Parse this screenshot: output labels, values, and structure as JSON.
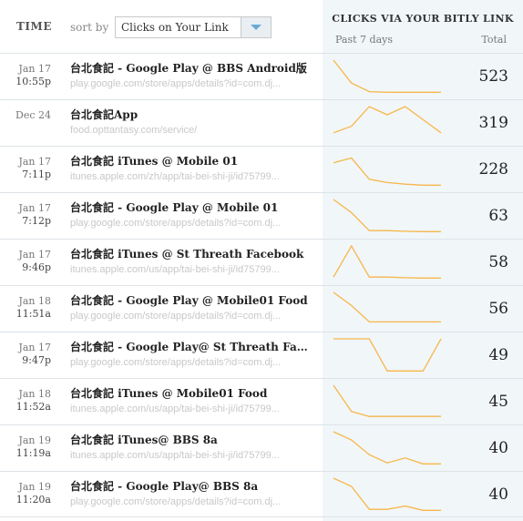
{
  "header": {
    "time_label": "TIME",
    "sort_label": "sort by",
    "sort_value": "Clicks on Your Link",
    "stats_title": "CLICKS VIA YOUR BITLY LINK",
    "past_label": "Past 7 days",
    "total_label": "Total"
  },
  "colors": {
    "spark_line": "#f6b74a",
    "stats_bg": "#f1f6f9",
    "dropdown_arrow": "#6aa9d6"
  },
  "rows": [
    {
      "date": "Jan 17",
      "time": "10:55p",
      "title": "台北食記 - Google Play @ BBS Android版",
      "url": "play.google.com/store/apps/details?id=com.dj...",
      "total": "523",
      "spark": [
        100,
        30,
        4,
        2,
        2,
        2,
        2
      ]
    },
    {
      "date": "Dec 24",
      "time": "",
      "title": "台北食記App",
      "url": "food.opttantasy.com/service/",
      "total": "319",
      "spark": [
        20,
        40,
        100,
        75,
        100,
        60,
        20
      ]
    },
    {
      "date": "Jan 17",
      "time": "7:11p",
      "title": "台北食記 iTunes @ Mobile 01",
      "url": "itunes.apple.com/zh/app/tai-bei-shi-ji/id75799...",
      "total": "228",
      "spark": [
        70,
        85,
        20,
        10,
        5,
        2,
        2
      ]
    },
    {
      "date": "Jan 17",
      "time": "7:12p",
      "title": "台北食記 - Google Play @ Mobile 01",
      "url": "play.google.com/store/apps/details?id=com.dj...",
      "total": "63",
      "spark": [
        100,
        60,
        5,
        5,
        3,
        2,
        2
      ]
    },
    {
      "date": "Jan 17",
      "time": "9:46p",
      "title": "台北食記 iTunes @ St Threath Facebook",
      "url": "itunes.apple.com/us/app/tai-bei-shi-ji/id75799...",
      "total": "58",
      "spark": [
        5,
        100,
        5,
        5,
        3,
        2,
        2
      ]
    },
    {
      "date": "Jan 18",
      "time": "11:51a",
      "title": "台北食記 - Google Play @ Mobile01 Food",
      "url": "play.google.com/store/apps/details?id=com.dj...",
      "total": "56",
      "spark": [
        100,
        60,
        10,
        10,
        10,
        10,
        10
      ]
    },
    {
      "date": "Jan 17",
      "time": "9:47p",
      "title": "台北食記 - Google Play@ St Threath Facebook",
      "url": "play.google.com/store/apps/details?id=com.dj...",
      "total": "49",
      "spark": [
        100,
        100,
        100,
        2,
        2,
        2,
        100
      ]
    },
    {
      "date": "Jan 18",
      "time": "11:52a",
      "title": "台北食記 iTunes @ Mobile01 Food",
      "url": "itunes.apple.com/us/app/tai-bei-shi-ji/id75799...",
      "total": "45",
      "spark": [
        100,
        20,
        5,
        5,
        5,
        5,
        5
      ]
    },
    {
      "date": "Jan 19",
      "time": "11:19a",
      "title": "台北食記 iTunes@ BBS 8a",
      "url": "itunes.apple.com/us/app/tai-bei-shi-ji/id75799...",
      "total": "40",
      "spark": [
        100,
        75,
        30,
        5,
        20,
        2,
        2
      ]
    },
    {
      "date": "Jan 19",
      "time": "11:20a",
      "title": "台北食記 - Google Play@ BBS 8a",
      "url": "play.google.com/store/apps/details?id=com.dj...",
      "total": "40",
      "spark": [
        100,
        75,
        5,
        5,
        15,
        2,
        2
      ]
    }
  ]
}
